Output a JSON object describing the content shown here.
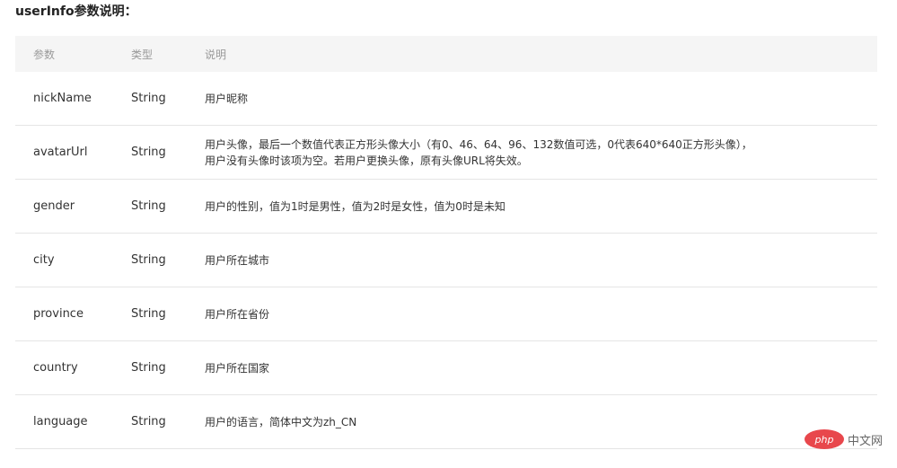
{
  "title": "userInfo参数说明：",
  "table": {
    "headers": [
      "参数",
      "类型",
      "说明"
    ],
    "rows": [
      {
        "name": "nickName",
        "type": "String",
        "desc": [
          "用户昵称"
        ]
      },
      {
        "name": "avatarUrl",
        "type": "String",
        "desc": [
          "用户头像，最后一个数值代表正方形头像大小（有0、46、64、96、132数值可选，0代表640*640正方形头像），",
          "用户没有头像时该项为空。若用户更换头像，原有头像URL将失效。"
        ]
      },
      {
        "name": "gender",
        "type": "String",
        "desc": [
          "用户的性别，值为1时是男性，值为2时是女性，值为0时是未知"
        ]
      },
      {
        "name": "city",
        "type": "String",
        "desc": [
          "用户所在城市"
        ]
      },
      {
        "name": "province",
        "type": "String",
        "desc": [
          "用户所在省份"
        ]
      },
      {
        "name": "country",
        "type": "String",
        "desc": [
          "用户所在国家"
        ]
      },
      {
        "name": "language",
        "type": "String",
        "desc": [
          "用户的语言，简体中文为zh_CN"
        ]
      }
    ]
  },
  "watermark": {
    "logo_text": "php",
    "site_text": "中文网"
  }
}
